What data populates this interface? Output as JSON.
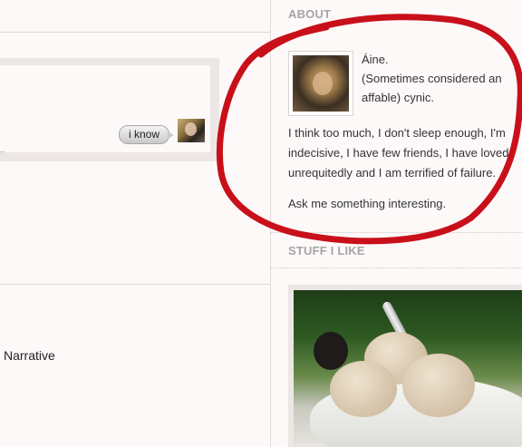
{
  "left": {
    "chat": {
      "bubble_text": "i know"
    },
    "narrative_label": "Narrative"
  },
  "sidebar": {
    "about": {
      "heading": "ABOUT",
      "name": "Áine.",
      "tagline": "(Sometimes considered an affable) cynic.",
      "bio": "I think too much, I don't sleep enough, I'm indecisive, I have few friends, I have loved unrequitedly and I am terrified of failure.",
      "ask": "Ask me something interesting."
    },
    "stuff": {
      "heading": "STUFF I LIKE"
    }
  },
  "colors": {
    "annotation": "#c8101a",
    "heading": "#a5a5a5",
    "background": "#fdf9f8"
  }
}
